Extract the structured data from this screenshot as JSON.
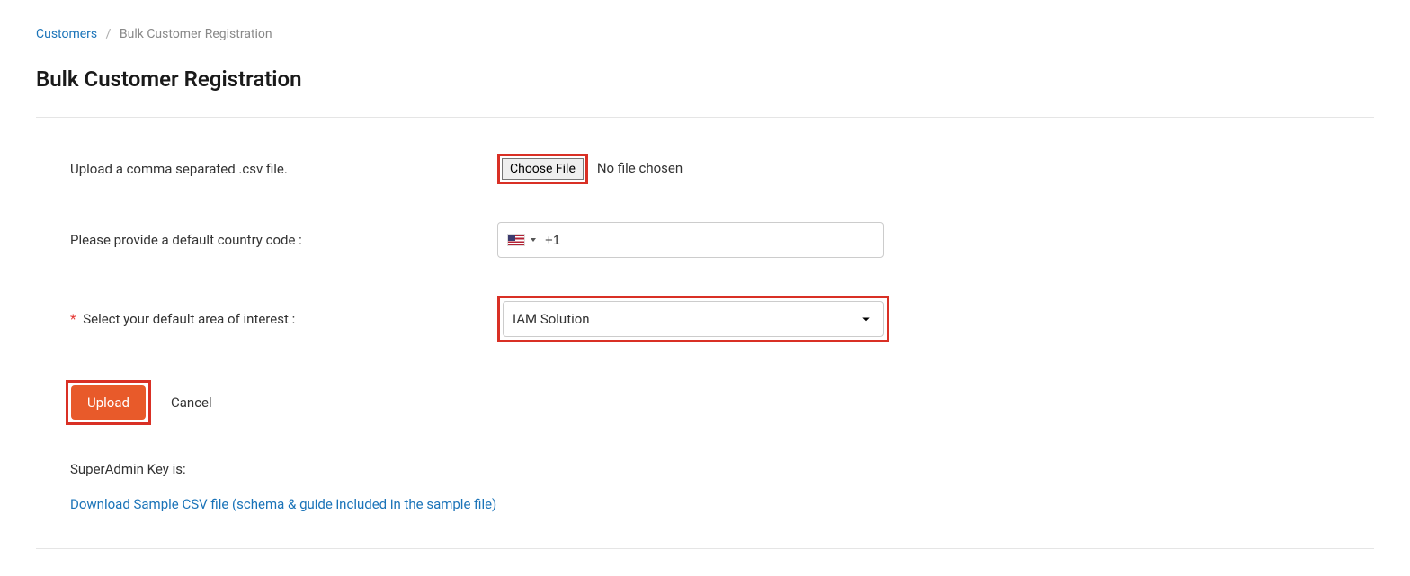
{
  "breadcrumb": {
    "parent": "Customers",
    "separator": "/",
    "current": "Bulk Customer Registration"
  },
  "page_title": "Bulk Customer Registration",
  "form": {
    "upload_csv_label": "Upload a comma separated .csv file.",
    "choose_file_button": "Choose File",
    "no_file_text": "No file chosen",
    "country_code_label": "Please provide a default country code :",
    "country_code_value": "+1",
    "area_interest_label": "Select your default area of interest :",
    "area_interest_value": "IAM Solution",
    "required_symbol": "*"
  },
  "actions": {
    "upload": "Upload",
    "cancel": "Cancel"
  },
  "footer": {
    "superadmin_label": "SuperAdmin Key is:",
    "superadmin_value": "",
    "download_link": "Download Sample CSV file (schema & guide included in the sample file)"
  }
}
